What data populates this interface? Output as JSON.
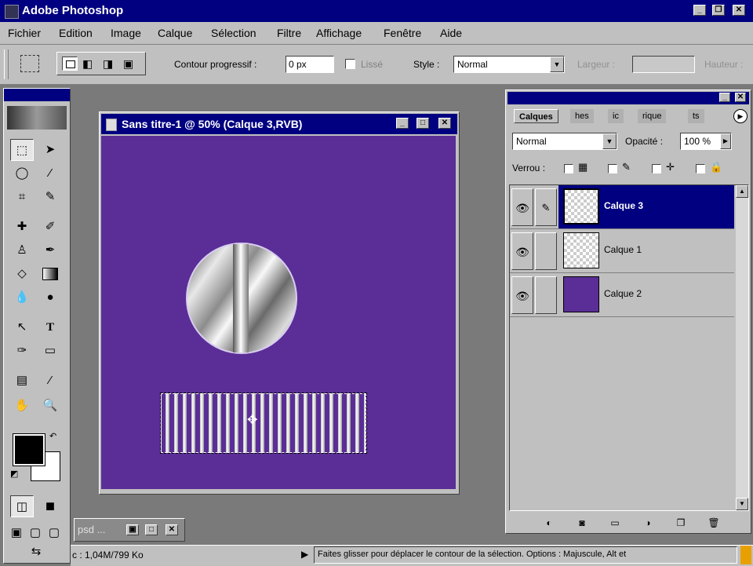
{
  "app": {
    "title": "Adobe Photoshop"
  },
  "menu": [
    "Fichier",
    "Edition",
    "Image",
    "Calque",
    "Sélection",
    "Filtre",
    "Affichage",
    "Fenêtre",
    "Aide"
  ],
  "options": {
    "feather_label": "Contour progressif :",
    "feather_value": "0 px",
    "antialias_label": "Lissé",
    "style_label": "Style :",
    "style_value": "Normal",
    "width_label": "Largeur :",
    "height_label": "Hauteur :"
  },
  "document": {
    "title": "Sans titre-1 @ 50% (Calque 3,RVB)",
    "canvas_color": "#5a2e96"
  },
  "mini_window": {
    "label": "psd ..."
  },
  "layers_panel": {
    "tabs": [
      "Calques",
      "hes",
      "ic",
      "rique",
      "ts"
    ],
    "blend_mode": "Normal",
    "opacity_label": "Opacité :",
    "opacity_value": "100 %",
    "lock_label": "Verrou :",
    "layers": [
      {
        "name": "Calque 3",
        "selected": true,
        "thumb": "transparent"
      },
      {
        "name": "Calque 1",
        "selected": false,
        "thumb": "transparent"
      },
      {
        "name": "Calque 2",
        "selected": false,
        "thumb": "#5a2e96"
      }
    ]
  },
  "status": {
    "doc_info": "c : 1,04M/799 Ko",
    "hint": "Faites glisser pour déplacer le contour de la sélection. Options : Majuscule, Alt et"
  },
  "colors": {
    "foreground": "#000000",
    "background": "#ffffff",
    "accent": "#000080"
  }
}
